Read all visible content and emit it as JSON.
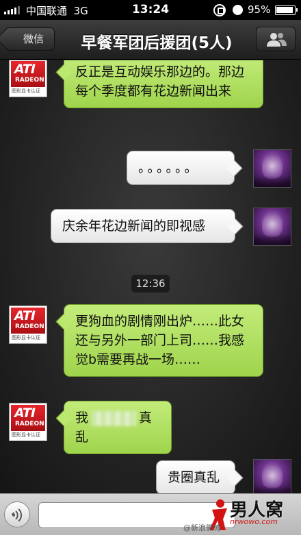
{
  "status_bar": {
    "carrier": "中国联通",
    "network": "3G",
    "time": "13:24",
    "battery": "95%"
  },
  "nav": {
    "back_label": "微信",
    "title": "早餐军团后援团(5人)"
  },
  "avatars": {
    "ati_brand": "ATI",
    "ati_sub": "RADEON",
    "ati_small": "图形显卡认证"
  },
  "messages": [
    {
      "sender": "other",
      "text": "反正是互动娱乐那边的。那边每个季度都有花边新闻出来"
    },
    {
      "sender": "me",
      "text": "。。。。。。"
    },
    {
      "sender": "me",
      "text": "庆余年花边新闻的即视感"
    },
    {
      "sender": "other",
      "text": "更狗血的剧情刚出炉……此女还与另外一部门上司……我感觉b需要再战一场……"
    },
    {
      "sender": "other",
      "text_before": "我",
      "text_after": "真乱"
    },
    {
      "sender": "me",
      "text": "贵圈真乱"
    }
  ],
  "timestamp": "12:36",
  "input": {
    "value": "",
    "placeholder": ""
  },
  "watermark": {
    "logo": "男人窝",
    "domain": "nrwowo.com",
    "weibo": "@新浪微博"
  },
  "colors": {
    "bubble_green": "#b5e265",
    "bubble_white": "#f2f2f2",
    "nav_dark": "#2a2a2a",
    "ati_red": "#d11a20"
  }
}
